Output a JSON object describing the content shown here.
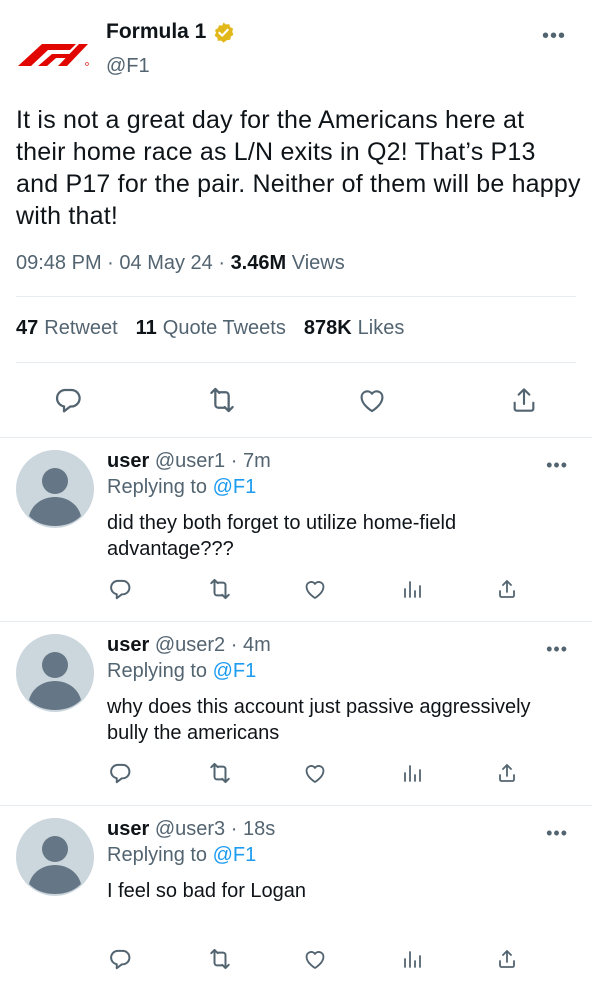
{
  "tweet": {
    "author_name": "Formula 1",
    "author_handle": "@F1",
    "logo": "f1-logo",
    "verified_icon": "verified-badge-icon",
    "text": "It is not a great day for the Americans here at their home race as L/N exits in Q2! That’s P13 and P17 for the pair. Neither of them will be happy with that!",
    "time": "09:48 PM",
    "date": "04 May 24",
    "views_count": "3.46M",
    "views_label": "Views",
    "retweets_count": "47",
    "retweets_label": "Retweet",
    "quote_count": "11",
    "quote_label": "Quote Tweets",
    "likes_count": "878K",
    "likes_label": "Likes",
    "actions": [
      "reply-icon",
      "retweet-icon",
      "like-icon",
      "share-icon"
    ]
  },
  "replies": [
    {
      "name": "user",
      "handle": "@user1",
      "time": "7m",
      "replying_prefix": "Replying to",
      "replying_to": "@F1",
      "text": "did they both forget to utilize home-field advantage???"
    },
    {
      "name": "user",
      "handle": "@user2",
      "time": "4m",
      "replying_prefix": "Replying to",
      "replying_to": "@F1",
      "text": "why does this account just passive aggressively bully the americans"
    },
    {
      "name": "user",
      "handle": "@user3",
      "time": "18s",
      "replying_prefix": "Replying to",
      "replying_to": "@F1",
      "text": "I feel so bad for Logan"
    }
  ],
  "reply_actions": [
    "reply-icon",
    "retweet-icon",
    "like-icon",
    "analytics-icon",
    "share-icon"
  ],
  "colors": {
    "accent": "#1d9bf0",
    "secondary_text": "#536471",
    "f1_red": "#e10600",
    "verified_gold": "#e2b719",
    "avatar_bg": "#ccd6dd",
    "avatar_figure": "#657786"
  }
}
